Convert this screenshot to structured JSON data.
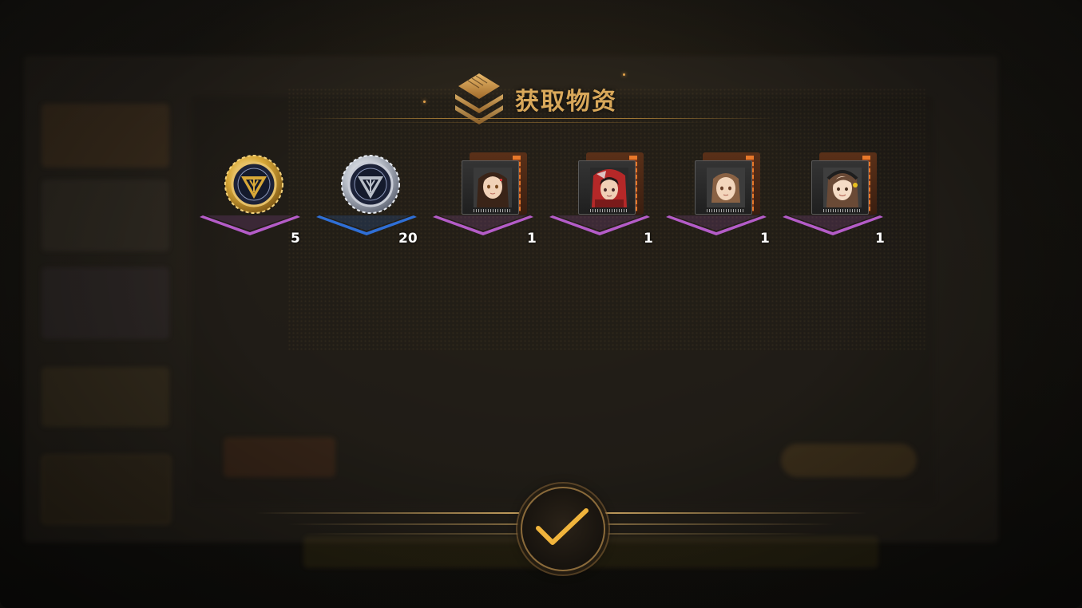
{
  "header": {
    "title": "获取物资",
    "icon": "stacked-diamond-icon"
  },
  "rewards": [
    {
      "type": "gold-emblem-token",
      "quantity": "5",
      "rarity_color": "#b45cc8"
    },
    {
      "type": "silver-emblem-token",
      "quantity": "20",
      "rarity_color": "#2f6fd6"
    },
    {
      "type": "character-card",
      "quantity": "1",
      "rarity_color": "#b45cc8"
    },
    {
      "type": "character-card",
      "quantity": "1",
      "rarity_color": "#b45cc8"
    },
    {
      "type": "character-card",
      "quantity": "1",
      "rarity_color": "#b45cc8"
    },
    {
      "type": "character-card",
      "quantity": "1",
      "rarity_color": "#b45cc8"
    }
  ],
  "confirm": {
    "icon": "checkmark-icon"
  },
  "colors": {
    "accent_gold": "#d9a85a",
    "rare_purple": "#b45cc8",
    "rare_blue": "#2f6fd6"
  }
}
